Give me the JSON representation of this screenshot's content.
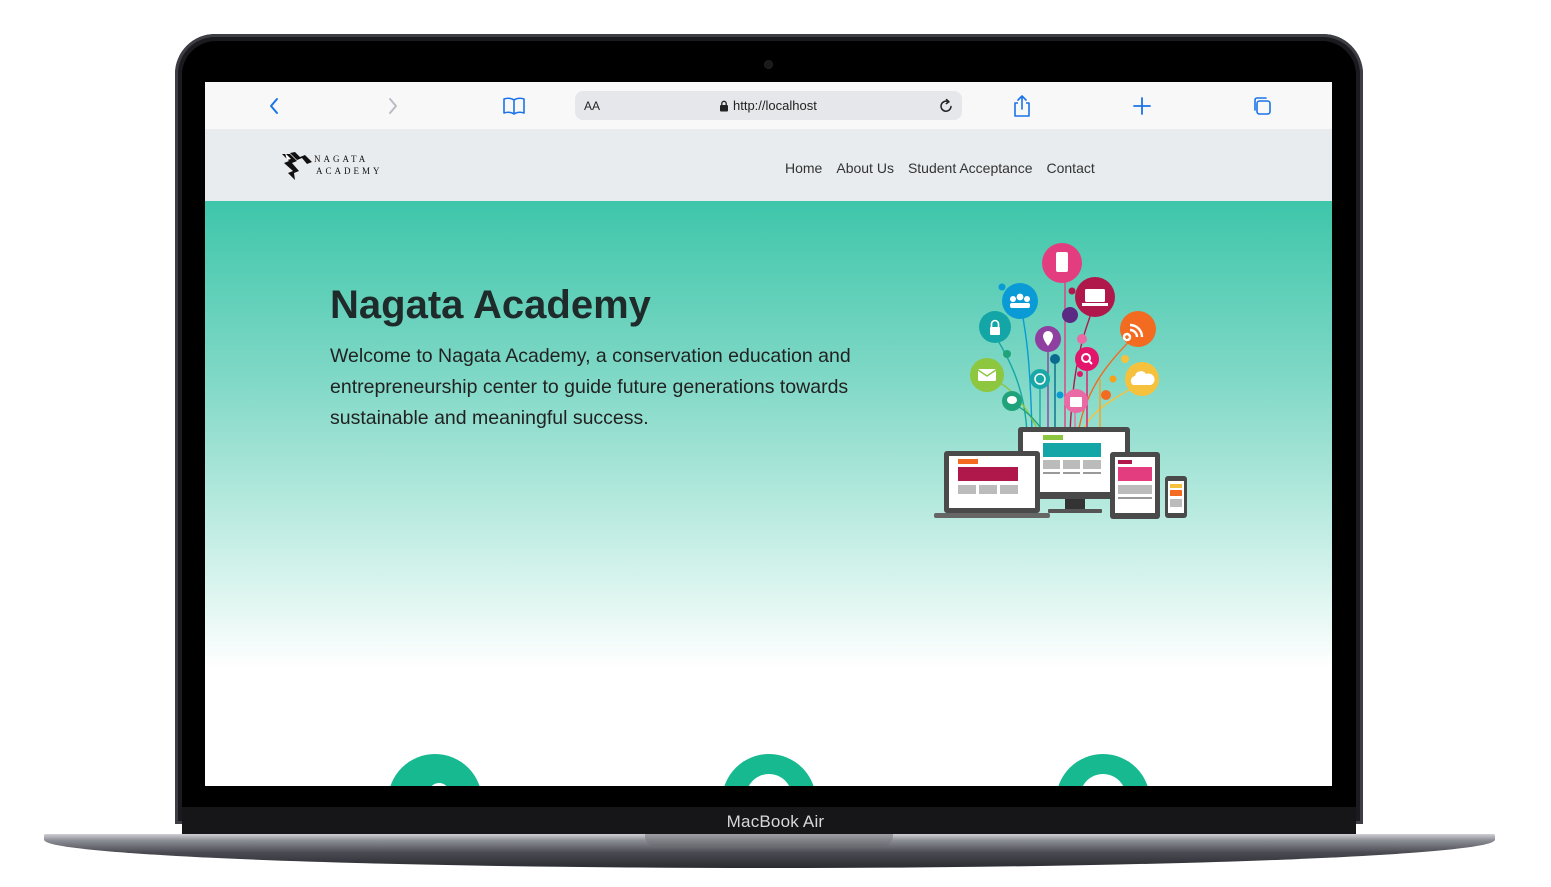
{
  "device": {
    "label": "MacBook Air"
  },
  "browser": {
    "back_icon": "chevron-left-icon",
    "forward_icon": "chevron-right-icon",
    "bookmarks_icon": "book-icon",
    "reader_label": "AA",
    "lock_icon": "lock-icon",
    "url": "http://localhost",
    "reload_icon": "reload-icon",
    "share_icon": "share-icon",
    "new_tab_icon": "plus-icon",
    "tabs_icon": "tabs-icon"
  },
  "site": {
    "logo": {
      "line1": "NAGATA",
      "line2": "ACADEMY"
    },
    "nav": [
      {
        "label": "Home"
      },
      {
        "label": "About Us"
      },
      {
        "label": "Student Acceptance"
      },
      {
        "label": "Contact"
      }
    ],
    "hero": {
      "title": "Nagata Academy",
      "text": "Welcome to Nagata Academy, a conservation education and entrepreneurship center to guide future generations towards sustainable and meaningful success."
    },
    "features": [
      {
        "icon": "cloud-icon"
      },
      {
        "icon": "circle-icon"
      },
      {
        "icon": "circle-icon"
      }
    ]
  },
  "colors": {
    "accent": "#17b990",
    "hero_top": "#3ec6aa",
    "navbar_bg": "#e9ecef",
    "browser_blue": "#1a73e8"
  }
}
